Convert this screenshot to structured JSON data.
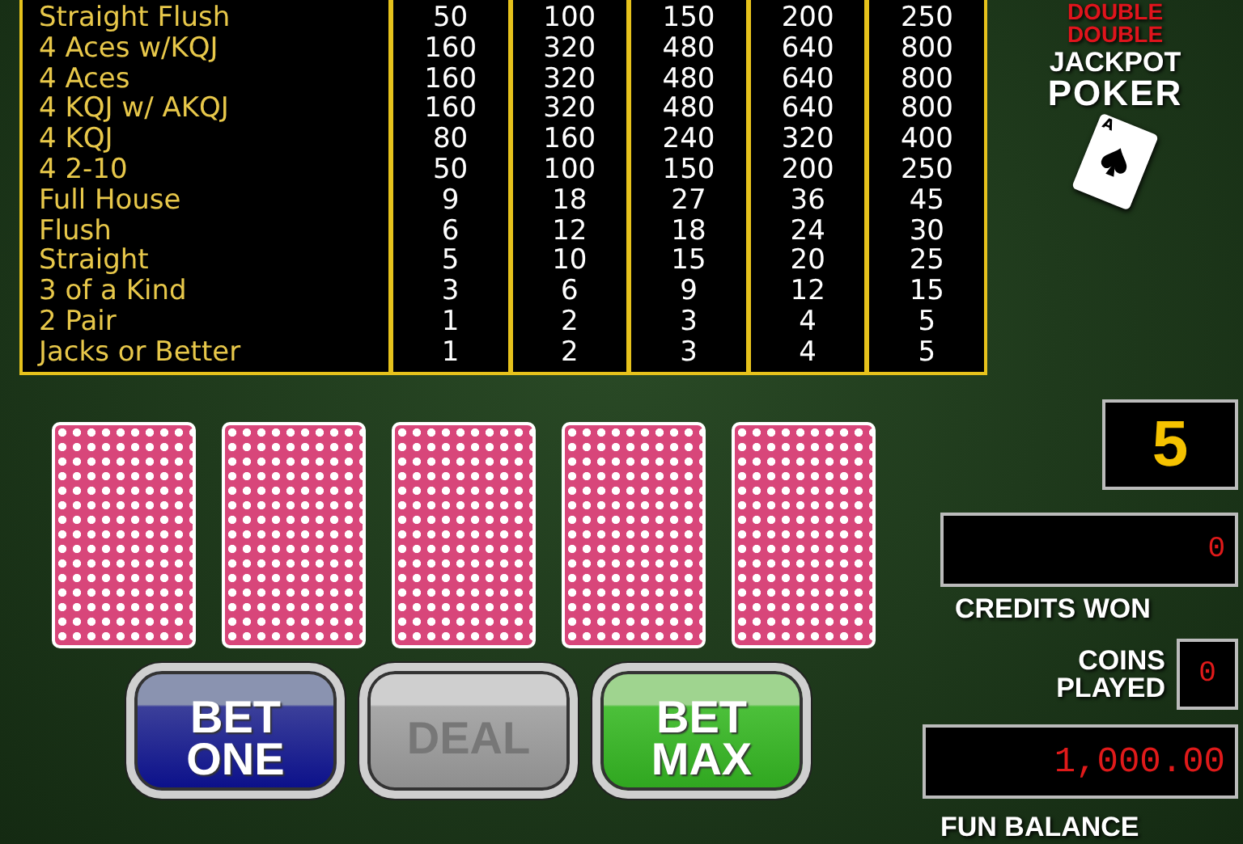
{
  "paytable": {
    "rows": [
      {
        "hand": "Straight Flush",
        "payouts": [
          "50",
          "100",
          "150",
          "200",
          "250"
        ]
      },
      {
        "hand": "4 Aces w/KQJ",
        "payouts": [
          "160",
          "320",
          "480",
          "640",
          "800"
        ]
      },
      {
        "hand": "4 Aces",
        "payouts": [
          "160",
          "320",
          "480",
          "640",
          "800"
        ]
      },
      {
        "hand": "4 KQJ w/ AKQJ",
        "payouts": [
          "160",
          "320",
          "480",
          "640",
          "800"
        ]
      },
      {
        "hand": "4 KQJ",
        "payouts": [
          "80",
          "160",
          "240",
          "320",
          "400"
        ]
      },
      {
        "hand": "4 2-10",
        "payouts": [
          "50",
          "100",
          "150",
          "200",
          "250"
        ]
      },
      {
        "hand": "Full House",
        "payouts": [
          "9",
          "18",
          "27",
          "36",
          "45"
        ]
      },
      {
        "hand": "Flush",
        "payouts": [
          "6",
          "12",
          "18",
          "24",
          "30"
        ]
      },
      {
        "hand": "Straight",
        "payouts": [
          "5",
          "10",
          "15",
          "20",
          "25"
        ]
      },
      {
        "hand": "3 of a Kind",
        "payouts": [
          "3",
          "6",
          "9",
          "12",
          "15"
        ]
      },
      {
        "hand": "2 Pair",
        "payouts": [
          "1",
          "2",
          "3",
          "4",
          "5"
        ]
      },
      {
        "hand": "Jacks or Better",
        "payouts": [
          "1",
          "2",
          "3",
          "4",
          "5"
        ]
      }
    ]
  },
  "logo": {
    "lines": [
      {
        "text": "DOUBLE",
        "kind": "accent"
      },
      {
        "text": "DOUBLE",
        "kind": "accent"
      },
      {
        "text": "JACKPOT",
        "kind": "plain"
      },
      {
        "text": "POKER",
        "kind": "large"
      }
    ],
    "card_rank": "A"
  },
  "cards": [
    {
      "kind": "back"
    },
    {
      "kind": "back"
    },
    {
      "kind": "back"
    },
    {
      "kind": "back"
    },
    {
      "kind": "back"
    }
  ],
  "buttons": [
    {
      "label": "BET ONE",
      "kind": "blue",
      "disabled": false
    },
    {
      "label": "DEAL",
      "kind": "gray",
      "disabled": true
    },
    {
      "label": "BET MAX",
      "kind": "green",
      "disabled": false
    }
  ],
  "bet": "5",
  "credits_won": {
    "value": "0",
    "label": "CREDITS WON"
  },
  "coins_played": {
    "value": "0",
    "label": "COINS PLAYED"
  },
  "fun_balance": {
    "value": "1,000.00",
    "label": "FUN BALANCE"
  }
}
